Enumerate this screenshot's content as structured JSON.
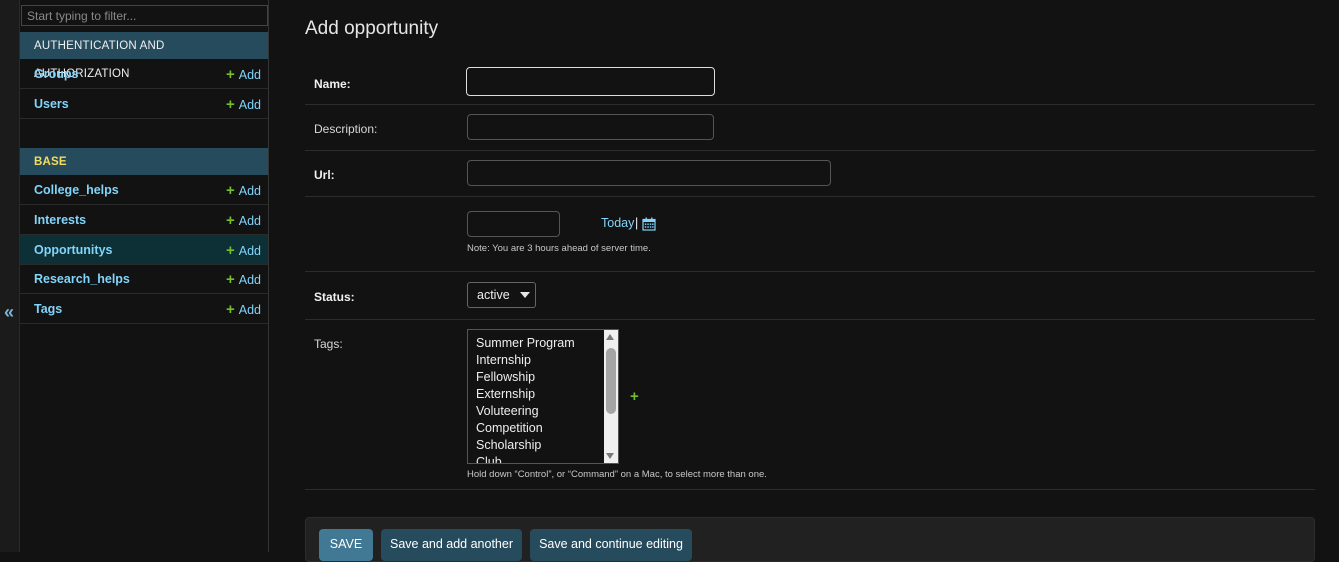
{
  "sidebar": {
    "filter_placeholder": "Start typing to filter...",
    "collapse_glyph": "«",
    "auth_module": {
      "header": "AUTHENTICATION AND AUTHORIZATION",
      "items": [
        {
          "label": "Groups",
          "add": "Add"
        },
        {
          "label": "Users",
          "add": "Add"
        }
      ]
    },
    "base_module": {
      "header": "BASE",
      "items": [
        {
          "label": "College_helps",
          "add": "Add"
        },
        {
          "label": "Interests",
          "add": "Add"
        },
        {
          "label": "Opportunitys",
          "add": "Add",
          "active": true
        },
        {
          "label": "Research_helps",
          "add": "Add"
        },
        {
          "label": "Tags",
          "add": "Add"
        }
      ]
    }
  },
  "form": {
    "title": "Add opportunity",
    "name_label": "Name:",
    "name_value": "",
    "description_label": "Description:",
    "description_value": "",
    "url_label": "Url:",
    "url_value": "",
    "date_value": "",
    "today_link": "Today",
    "date_separator": "|",
    "timezone_note": "Note: You are 3 hours ahead of server time.",
    "status_label": "Status:",
    "status_value": "active",
    "tags_label": "Tags:",
    "tags_options": [
      "Summer Program",
      "Internship",
      "Fellowship",
      "Externship",
      "Voluteering",
      "Competition",
      "Scholarship",
      "Club"
    ],
    "add_related_glyph": "+",
    "tags_help": "Hold down “Control”, or “Command” on a Mac, to select more than one."
  },
  "submit": {
    "save": "Save",
    "save_add_another": "Save and add another",
    "save_continue": "Save and continue editing"
  },
  "colors": {
    "module_header_bg": "#264b5d",
    "link": "#81d4fa",
    "add_plus": "#70bf2b",
    "active_row_bg": "#0c3036",
    "base_header_text": "#f5dd5d"
  },
  "icons": {
    "collapse": "double-chevron-left-icon",
    "add": "plus-icon",
    "calendar": "calendar-icon"
  }
}
